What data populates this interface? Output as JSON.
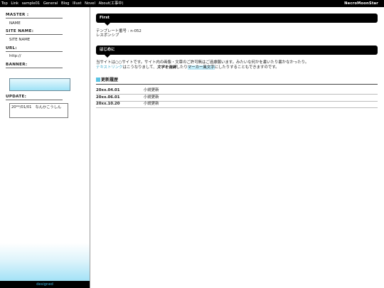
{
  "topbar": {
    "nav": [
      "Top",
      "Link",
      "sample01",
      "General",
      "Blog",
      "Illust",
      "Novel",
      "About(工事中)"
    ],
    "brand": "NecroMoonStar"
  },
  "sidebar": {
    "master_label": "MASTER :",
    "master_value": "NAME",
    "site_name_label": "SITE NAME:",
    "site_name_value": "SITE NAME",
    "url_label": "URL:",
    "url_value": "http://",
    "banner_label": "BANNER:",
    "update_label": "UPDATE:",
    "update_text": "20**/01/01　なんかこうしん",
    "designed": "designed"
  },
  "main": {
    "section1_title": "First",
    "section1_line1": "テンプレート番号 : n-052",
    "section1_line2": "レスポンシブ",
    "section2_title": "はじめに",
    "intro_line1": "当サイトは○○サイトです。サイト内の画像・文章のご許可無はご遠慮願います。みたいな何かを書いたり書かなかったり。",
    "intro_link": "テキストリンク",
    "intro_mid1": "はこうなりまして、",
    "intro_bold": "文字を強調",
    "intro_mid2": "したり",
    "intro_hl": "マーカー風文字",
    "intro_end": "にしたりすることもできますのです。",
    "history_title": "更新履歴",
    "history": [
      {
        "date": "20xx.04.01",
        "note": "小説更新"
      },
      {
        "date": "20xx.06.01",
        "note": "小説更新"
      },
      {
        "date": "20xx.10.20",
        "note": "小説更新"
      }
    ]
  },
  "colors": {
    "accent": "#39a9c9",
    "sidebar_gradient_end": "#8fdcf5",
    "header_bg": "#000000"
  }
}
